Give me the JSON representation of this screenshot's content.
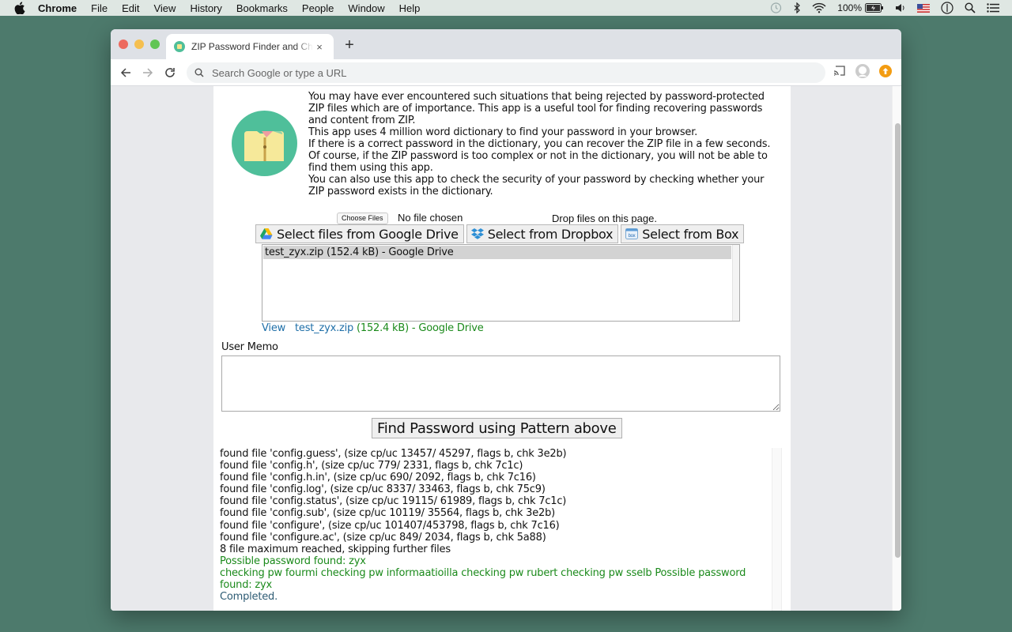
{
  "menubar": {
    "app_name": "Chrome",
    "items": [
      "File",
      "Edit",
      "View",
      "History",
      "Bookmarks",
      "People",
      "Window",
      "Help"
    ],
    "battery": "100%",
    "status_icons": [
      "time-machine-icon",
      "bluetooth-icon",
      "wifi-icon",
      "battery-icon",
      "volume-icon",
      "us-flag-input-icon",
      "user-switch-icon",
      "spotlight-search-icon",
      "notification-center-icon"
    ]
  },
  "browser": {
    "tab_title": "ZIP Password Finder and Checker",
    "tab_close": "×",
    "new_tab": "+",
    "omnibox_placeholder": "Search Google or type a URL"
  },
  "intro": {
    "paragraphs": [
      "You may have ever encountered such situations that being rejected by password-protected ZIP files which are of importance. This app is a useful tool for finding recovering passwords and content from ZIP.",
      "This app uses 4 million word dictionary to find your password in your browser.",
      "If there is a correct password in the dictionary, you can recover the ZIP file in a few seconds.",
      "Of course, if the ZIP password is too complex or not in the dictionary, you will not be able to find them using this app.",
      "You can also use this app to check the security of your password by checking whether your ZIP password exists in the dictionary."
    ]
  },
  "file_input": {
    "choose_label": "Choose Files",
    "status": "No file chosen",
    "drop_message": "Drop files on this page."
  },
  "cloud_buttons": [
    {
      "label": "Select files from Google Drive",
      "icon": "google-drive-icon"
    },
    {
      "label": "Select from Dropbox",
      "icon": "dropbox-icon"
    },
    {
      "label": "Select from Box",
      "icon": "box-icon"
    }
  ],
  "file_list": {
    "items": [
      "test_zyx.zip (152.4 kB) - Google Drive"
    ],
    "selected_index": 0
  },
  "view_line": {
    "view_label": "View",
    "file_name": "test_zyx.zip",
    "details": " (152.4 kB) - Google Drive"
  },
  "memo": {
    "label": "User Memo",
    "value": ""
  },
  "find_button": "Find Password using Pattern above",
  "log": {
    "lines": [
      "found file 'config.guess', (size cp/uc 13457/ 45297, flags b, chk 3e2b)",
      "found file 'config.h', (size cp/uc 779/ 2331, flags b, chk 7c1c)",
      "found file 'config.h.in', (size cp/uc 690/ 2092, flags b, chk 7c16)",
      "found file 'config.log', (size cp/uc 8337/ 33463, flags b, chk 75c9)",
      "found file 'config.status', (size cp/uc 19115/ 61989, flags b, chk 7c1c)",
      "found file 'config.sub', (size cp/uc 10119/ 35564, flags b, chk 3e2b)",
      "found file 'configure', (size cp/uc 101407/453798, flags b, chk 7c16)",
      "found file 'configure.ac', (size cp/uc 849/ 2034, flags b, chk 5a88)",
      "8 file maximum reached, skipping further files"
    ],
    "found_message": "Possible password found: zyx",
    "checking_message": "checking pw fourmi checking pw informaatioilla checking pw rubert checking pw sselb Possible password found: zyx",
    "completed_message": "Completed."
  },
  "colors": {
    "desktop": "#4d7a6c",
    "success_green": "#1b8a1b",
    "link_blue": "#1f6fa8",
    "logo_green": "#4fbf9a",
    "logo_folder": "#f6e99a"
  }
}
